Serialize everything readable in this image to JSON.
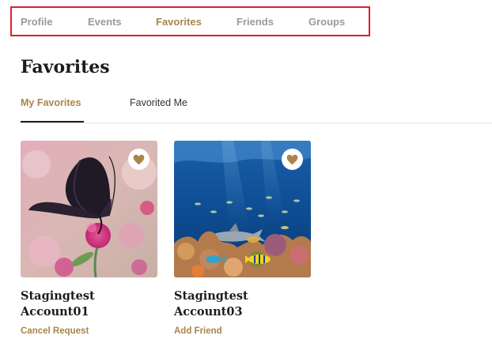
{
  "nav": {
    "items": [
      {
        "label": "Profile"
      },
      {
        "label": "Events"
      },
      {
        "label": "Favorites"
      },
      {
        "label": "Friends"
      },
      {
        "label": "Groups"
      }
    ]
  },
  "page": {
    "title": "Favorites"
  },
  "tabs": [
    {
      "label": "My Favorites"
    },
    {
      "label": "Favorited Me"
    }
  ],
  "cards": [
    {
      "name": "Stagingtest Account01",
      "action": "Cancel Request",
      "icon": "heart-icon"
    },
    {
      "name": "Stagingtest Account03",
      "action": "Add Friend",
      "icon": "heart-icon"
    }
  ],
  "colors": {
    "accent": "#a8864a",
    "highlight_border": "#e0202a",
    "muted": "#9a9a9a"
  }
}
